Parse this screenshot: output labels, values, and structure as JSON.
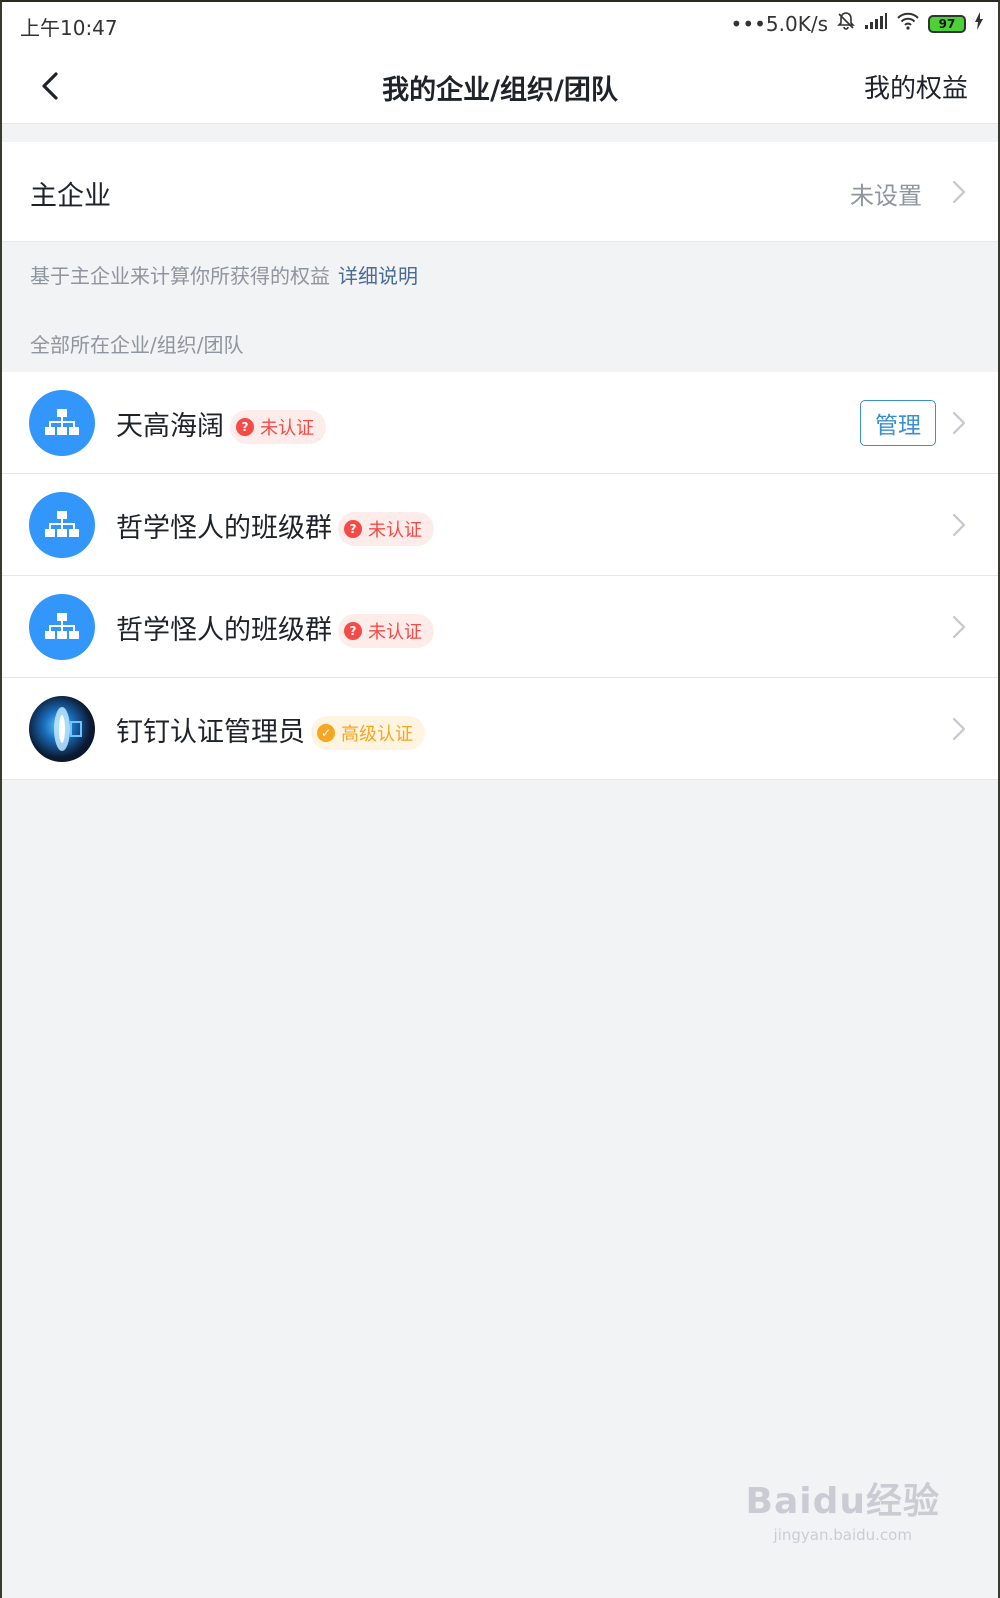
{
  "status_bar": {
    "time": "上午10:47",
    "network_speed": "•••5.0K/s",
    "battery": "97"
  },
  "nav": {
    "title": "我的企业/组织/团队",
    "right_action": "我的权益"
  },
  "main_enterprise": {
    "label": "主企业",
    "value": "未设置"
  },
  "hint": {
    "text": "基于主企业来计算你所获得的权益",
    "link": "详细说明"
  },
  "section_label": "全部所在企业/组织/团队",
  "orgs": [
    {
      "name": "天高海阔",
      "badge": "未认证",
      "manage": "管理"
    },
    {
      "name": "哲学怪人的班级群",
      "badge": "未认证"
    },
    {
      "name": "哲学怪人的班级群",
      "badge": "未认证"
    },
    {
      "name": "钉钉认证管理员",
      "badge": "高级认证"
    }
  ],
  "watermark": {
    "main": "Baidu经验",
    "sub": "jingyan.baidu.com"
  },
  "colors": {
    "accent": "#3296fa",
    "unverified": "#f54a45",
    "advanced": "#f5a623"
  }
}
